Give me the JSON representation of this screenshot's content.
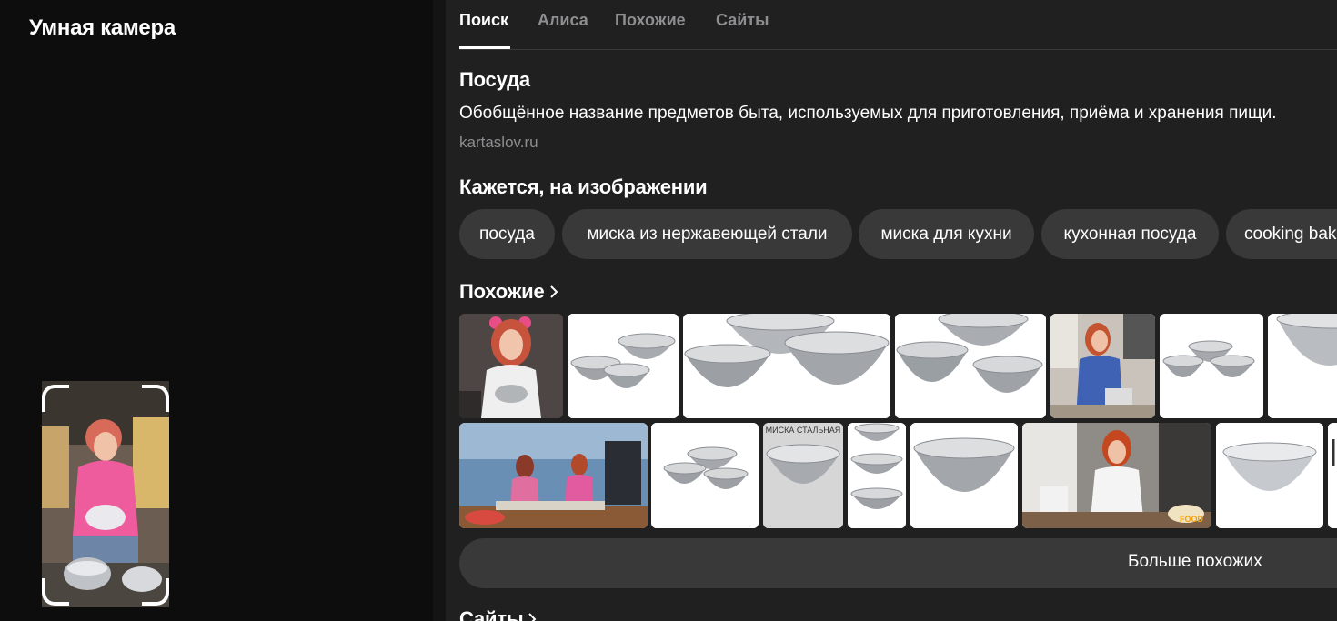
{
  "app": {
    "title": "Умная камера"
  },
  "tabs": [
    {
      "label": "Поиск",
      "active": true
    },
    {
      "label": "Алиса",
      "active": false
    },
    {
      "label": "Похожие",
      "active": false
    },
    {
      "label": "Сайты",
      "active": false
    }
  ],
  "definition": {
    "title": "Посуда",
    "text": "Обобщённое название предметов быта, используемых для приготовления, приёма и хранения пищи.",
    "source": "kartaslov.ru"
  },
  "detected": {
    "title": "Кажется, на изображении",
    "chips": [
      "посуда",
      "миска из нержавеющей стали",
      "миска для кухни",
      "кухонная посуда",
      "cooking bak"
    ]
  },
  "similar": {
    "title": "Похожие",
    "more_label": "Больше похожих",
    "thumb_text": {
      "bowl_steel_caption": "МИСКА СТАЛЬНАЯ",
      "food_badge": "FOOD"
    }
  },
  "sites": {
    "title": "Сайты"
  },
  "colors": {
    "panel": "#202021",
    "chip": "#39393a",
    "muted": "#8e8e90",
    "accent": "#ffffff"
  }
}
